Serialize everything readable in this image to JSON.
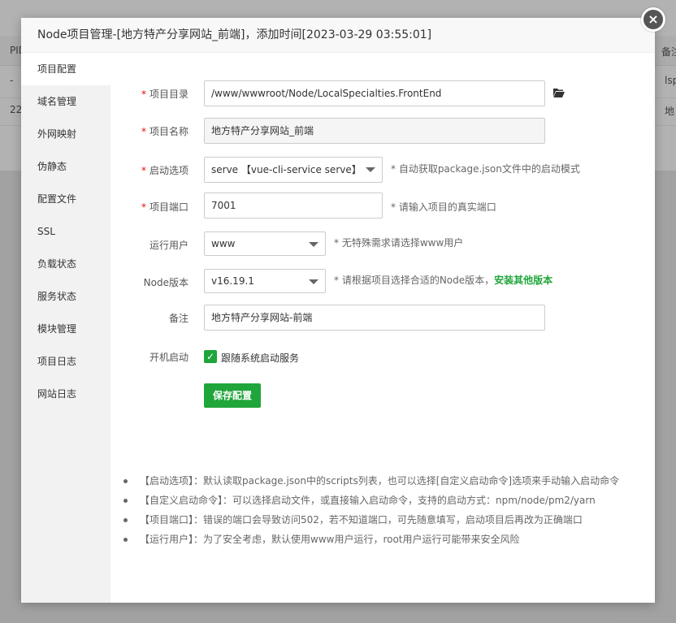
{
  "background": {
    "headers": [
      "PID",
      "备注"
    ],
    "rows": [
      {
        "pid": "-",
        "note": "lsp"
      },
      {
        "pid": "22",
        "note": "地"
      }
    ]
  },
  "modal": {
    "title": "Node项目管理-[地方特产分享网站_前端]，添加时间[2023-03-29 03:55:01]",
    "close_icon": "close-icon"
  },
  "sidebar": {
    "items": [
      {
        "label": "项目配置",
        "active": true
      },
      {
        "label": "域名管理"
      },
      {
        "label": "外网映射"
      },
      {
        "label": "伪静态"
      },
      {
        "label": "配置文件"
      },
      {
        "label": "SSL"
      },
      {
        "label": "负载状态"
      },
      {
        "label": "服务状态"
      },
      {
        "label": "模块管理"
      },
      {
        "label": "项目日志"
      },
      {
        "label": "网站日志"
      }
    ]
  },
  "form": {
    "required_mark": "*",
    "project_dir": {
      "label": "项目目录",
      "value": "/www/wwwroot/Node/LocalSpecialties.FrontEnd",
      "icon": "folder-open-icon"
    },
    "project_name": {
      "label": "项目名称",
      "value": "地方特产分享网站_前端"
    },
    "start_option": {
      "label": "启动选项",
      "value": "serve 【vue-cli-service serve】",
      "hint": "* 自动获取package.json文件中的启动模式"
    },
    "project_port": {
      "label": "项目端口",
      "value": "7001",
      "hint": "* 请输入项目的真实端口"
    },
    "run_user": {
      "label": "运行用户",
      "value": "www",
      "hint": "* 无特殊需求请选择www用户"
    },
    "node_version": {
      "label": "Node版本",
      "value": "v16.19.1",
      "hint": "* 请根据项目选择合适的Node版本，",
      "link": "安装其他版本"
    },
    "remark": {
      "label": "备注",
      "value": "地方特产分享网站-前端"
    },
    "autostart": {
      "label": "开机启动",
      "checkbox_label": "跟随系统启动服务",
      "checked": true
    },
    "save_label": "保存配置"
  },
  "notes": [
    "【启动选项】：默认读取package.json中的scripts列表，也可以选择[自定义启动命令]选项来手动输入启动命令",
    "【自定义启动命令】：可以选择启动文件，或直接输入启动命令，支持的启动方式：npm/node/pm2/yarn",
    "【项目端口】：错误的端口会导致访问502，若不知道端口，可先随意填写，启动项目后再改为正确端口",
    "【运行用户】：为了安全考虑，默认使用www用户运行，root用户运行可能带来安全风险"
  ],
  "colors": {
    "accent": "#20a53a",
    "required": "#ef0808"
  }
}
